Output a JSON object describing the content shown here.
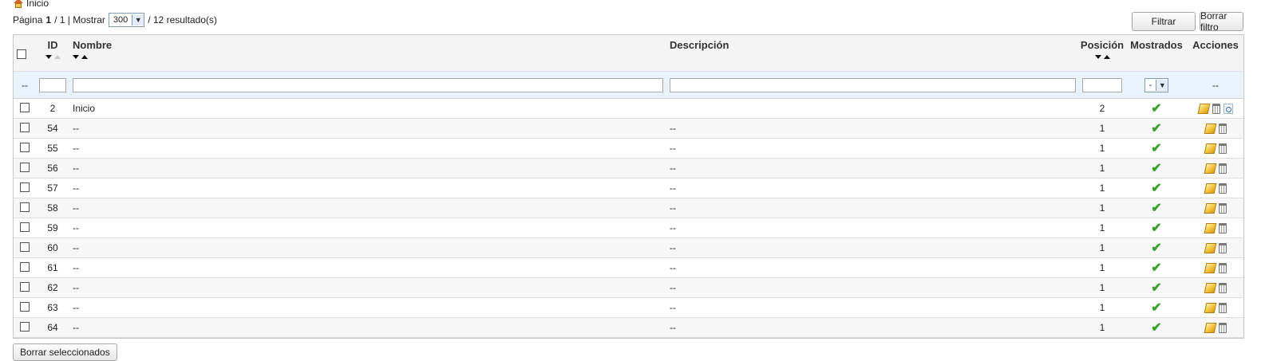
{
  "breadcrumb": {
    "icon": "home-icon",
    "label": "Inicio"
  },
  "pager": {
    "page_prefix": "Página",
    "page_current": "1",
    "page_sep": "/ 1 | Mostrar",
    "show_value": "300",
    "results": "/ 12 resultado(s)"
  },
  "buttons": {
    "filter": "Filtrar",
    "clear": "Borrar filtro",
    "delete_selected": "Borrar seleccionados"
  },
  "columns": {
    "id": "ID",
    "name": "Nombre",
    "description": "Descripción",
    "position": "Posición",
    "shown": "Mostrados",
    "actions": "Acciones"
  },
  "filter_row": {
    "select_label": "--",
    "shown_value": "-",
    "actions_label": "--"
  },
  "colors": {
    "check": "#3aa12f",
    "filter_bg": "#eaf3fb",
    "header_bg": "#f4f4f4"
  },
  "rows": [
    {
      "id": "2",
      "name": "Inicio",
      "description": "",
      "position": "2",
      "shown": "✔",
      "view": true
    },
    {
      "id": "54",
      "name": "--",
      "description": "--",
      "position": "1",
      "shown": "✔",
      "view": false
    },
    {
      "id": "55",
      "name": "--",
      "description": "--",
      "position": "1",
      "shown": "✔",
      "view": false
    },
    {
      "id": "56",
      "name": "--",
      "description": "--",
      "position": "1",
      "shown": "✔",
      "view": false
    },
    {
      "id": "57",
      "name": "--",
      "description": "--",
      "position": "1",
      "shown": "✔",
      "view": false
    },
    {
      "id": "58",
      "name": "--",
      "description": "--",
      "position": "1",
      "shown": "✔",
      "view": false
    },
    {
      "id": "59",
      "name": "--",
      "description": "--",
      "position": "1",
      "shown": "✔",
      "view": false
    },
    {
      "id": "60",
      "name": "--",
      "description": "--",
      "position": "1",
      "shown": "✔",
      "view": false
    },
    {
      "id": "61",
      "name": "--",
      "description": "--",
      "position": "1",
      "shown": "✔",
      "view": false
    },
    {
      "id": "62",
      "name": "--",
      "description": "--",
      "position": "1",
      "shown": "✔",
      "view": false
    },
    {
      "id": "63",
      "name": "--",
      "description": "--",
      "position": "1",
      "shown": "✔",
      "view": false
    },
    {
      "id": "64",
      "name": "--",
      "description": "--",
      "position": "1",
      "shown": "✔",
      "view": false
    }
  ]
}
